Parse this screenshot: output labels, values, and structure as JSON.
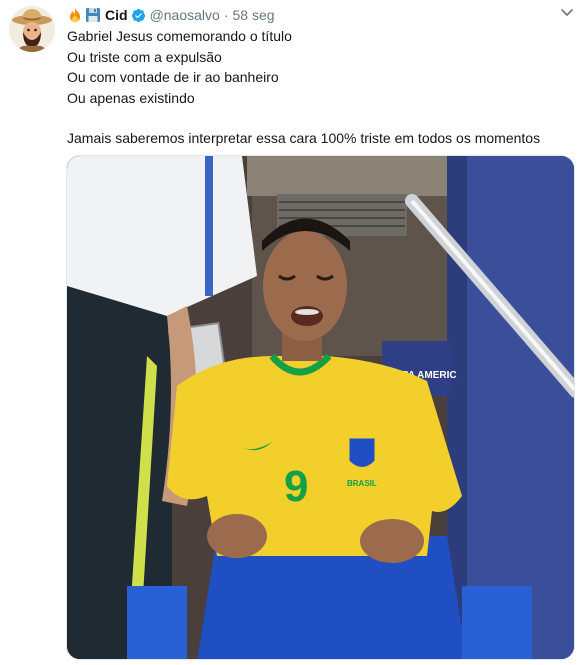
{
  "user": {
    "display_name": "Cid",
    "handle": "@naosalvo",
    "separator": "·",
    "timestamp": "58 seg",
    "verified": true,
    "name_emojis": [
      "fire-icon",
      "floppy-disk-icon"
    ]
  },
  "tweet": {
    "lines": [
      "Gabriel Jesus comemorando o título",
      "Ou triste com a expulsão",
      "Ou com vontade de ir ao banheiro",
      "Ou apenas existindo",
      "Jamais saberemos interpretar essa cara 100% triste em todos os momentos"
    ]
  },
  "media": {
    "jersey_number": "9",
    "crest_text": "BRASIL",
    "banner_text": "COPA AMERIC"
  },
  "colors": {
    "verified": "#1da1f2",
    "secondary_text": "#657786",
    "jersey_yellow": "#f2cf2a",
    "jersey_green": "#14a046",
    "shorts_blue": "#1f4fc2"
  }
}
